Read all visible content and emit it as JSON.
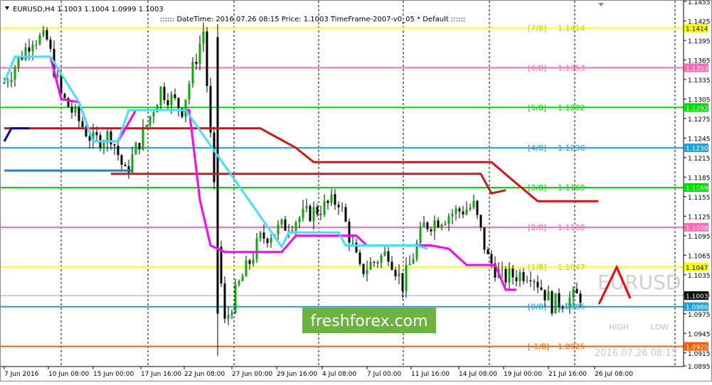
{
  "symbol_info": "EURUSD,H4  1.1003 1.1004 1.0999 1.1003",
  "info_line": ":::::: DateTime: 2016.07.26 08:15    Price: 1.1003    TimeFrame-2007-v0_05    *  Default  ::::::",
  "watermark": "EURUSD",
  "brand": "freshforex.com",
  "high_label": "HIGH",
  "low_label": "LOW",
  "datetime_footer": "2016.07.26 08:15",
  "chart_data": {
    "type": "candlestick",
    "title": "EURUSD,H4",
    "ylim": [
      1.0894,
      1.1456
    ],
    "y_ticks": [
      "1.1455",
      "1.1425",
      "1.1395",
      "1.1365",
      "1.1335",
      "1.1305",
      "1.1275",
      "1.1245",
      "1.1215",
      "1.1185",
      "1.1155",
      "1.1125",
      "1.1095",
      "1.1065",
      "1.1035",
      "1.1005",
      "1.0975",
      "1.0945",
      "1.0915",
      "1.0895"
    ],
    "x_labels": [
      "7 Jun 2016",
      "10 Jun 08:00",
      "15 Jun 00:00",
      "17 Jun 16:00",
      "22 Jun 08:00",
      "27 Jun 00:00",
      "29 Jun 16:00",
      "4 Jul 08:00",
      "7 Jul 00:00",
      "11 Jul 16:00",
      "14 Jul 08:00",
      "19 Jul 00:00",
      "21 Jul 16:00",
      "26 Jul 08:00"
    ],
    "current_price": 1.1003,
    "murrey_levels": [
      {
        "name": "[7/8]",
        "value": 1.1414,
        "label": "1.1414",
        "color": "#ffff00"
      },
      {
        "name": "[6/8]",
        "value": 1.1353,
        "label": "1.1353",
        "color": "#ff69b4"
      },
      {
        "name": "[5/8]",
        "value": 1.1292,
        "label": "1.1292",
        "color": "#00e000"
      },
      {
        "name": "[4/8]",
        "value": 1.123,
        "label": "1.1230",
        "color": "#1e9fe0"
      },
      {
        "name": "[3/8]",
        "value": 1.1169,
        "label": "1.1169",
        "color": "#00e000"
      },
      {
        "name": "[2/8]",
        "value": 1.1108,
        "label": "1.1108",
        "color": "#ff69b4"
      },
      {
        "name": "[1/8]",
        "value": 1.1047,
        "label": "1.1047",
        "color": "#ffff00"
      },
      {
        "name": "[0/8]",
        "value": 1.0986,
        "label": "1.0986",
        "color": "#1e9fe0"
      },
      {
        "name": "[-1/8]",
        "value": 1.0925,
        "label": "1.0925",
        "color": "#ff5a00"
      }
    ],
    "price_tags": [
      "1.1414",
      "1.1353",
      "1.1292",
      "1.1230",
      "1.1169",
      "1.1108",
      "1.1047",
      "1.1003",
      "1.0986",
      "1.0925"
    ],
    "red_trend": [
      [
        0,
        1.126
      ],
      [
        72,
        1.126
      ],
      [
        82,
        1.123
      ],
      [
        87,
        1.1208
      ],
      [
        137,
        1.1208
      ],
      [
        143,
        1.118
      ],
      [
        150,
        1.1148
      ],
      [
        167,
        1.1148
      ]
    ],
    "red_trend2": [
      [
        30,
        1.119
      ],
      [
        134,
        1.119
      ],
      [
        137,
        1.116
      ],
      [
        141,
        1.1165
      ]
    ],
    "magenta_trend": [
      [
        13,
        1.137
      ],
      [
        16,
        1.1305
      ],
      [
        21,
        1.13
      ],
      [
        25,
        1.124
      ],
      [
        32,
        1.124
      ],
      [
        37,
        1.1288
      ],
      [
        52,
        1.1288
      ],
      [
        55,
        1.115
      ],
      [
        58,
        1.108
      ],
      [
        62,
        1.107
      ],
      [
        78,
        1.107
      ],
      [
        82,
        1.1095
      ],
      [
        99,
        1.1095
      ],
      [
        102,
        1.108
      ],
      [
        120,
        1.108
      ],
      [
        125,
        1.1075
      ],
      [
        130,
        1.105
      ],
      [
        138,
        1.105
      ],
      [
        141,
        1.1012
      ],
      [
        144,
        1.1012
      ]
    ],
    "cyan_trend": [
      [
        0,
        1.133
      ],
      [
        3,
        1.137
      ],
      [
        13,
        1.137
      ],
      [
        21,
        1.13
      ],
      [
        25,
        1.124
      ],
      [
        32,
        1.124
      ],
      [
        35,
        1.1288
      ],
      [
        51,
        1.1288
      ],
      [
        78,
        1.1078
      ],
      [
        80,
        1.11
      ],
      [
        94,
        1.11
      ],
      [
        96,
        1.108
      ],
      [
        116,
        1.108
      ],
      [
        119,
        1.1075
      ]
    ],
    "blue_trend": [
      [
        0,
        1.124
      ],
      [
        2,
        1.126
      ],
      [
        7,
        1.126
      ]
    ],
    "blue_trend2": [
      [
        0,
        1.1195
      ],
      [
        36,
        1.1195
      ]
    ]
  }
}
